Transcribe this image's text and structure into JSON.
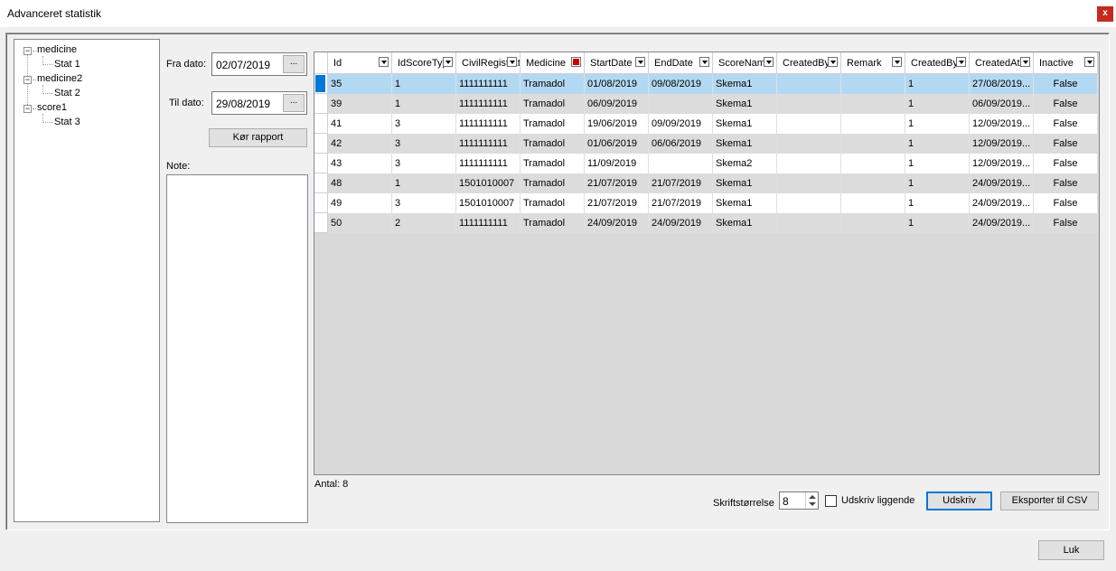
{
  "window": {
    "title": "Advanceret statistik",
    "close_label": "x"
  },
  "tree": {
    "nodes": [
      {
        "label": "medicine",
        "children": [
          "Stat 1"
        ]
      },
      {
        "label": "medicine2",
        "children": [
          "Stat 2"
        ]
      },
      {
        "label": "score1",
        "children": [
          "Stat 3"
        ]
      }
    ],
    "expander_glyph": "−"
  },
  "filters": {
    "from_label": "Fra dato:",
    "from_value": "02/07/2019",
    "to_label": "Til dato:",
    "to_value": "29/08/2019",
    "picker_label": "...",
    "run_button": "Kør rapport",
    "note_label": "Note:"
  },
  "grid": {
    "columns": [
      {
        "label": "Id",
        "width": 71,
        "filter_active": false
      },
      {
        "label": "IdScoreType",
        "width": 71,
        "filter_active": false
      },
      {
        "label": "CivilRegistrationNumber",
        "width": 71,
        "filter_active": false
      },
      {
        "label": "Medicine",
        "width": 71,
        "filter_active": true
      },
      {
        "label": "StartDate",
        "width": 71,
        "filter_active": false
      },
      {
        "label": "EndDate",
        "width": 71,
        "filter_active": false
      },
      {
        "label": "ScoreName",
        "width": 71,
        "filter_active": false
      },
      {
        "label": "CreatedBy",
        "width": 71,
        "filter_active": false
      },
      {
        "label": "Remark",
        "width": 71,
        "filter_active": false
      },
      {
        "label": "CreatedBy",
        "width": 71,
        "filter_active": false
      },
      {
        "label": "CreatedAt",
        "width": 71,
        "filter_active": false
      },
      {
        "label": "Inactive",
        "width": 71,
        "filter_active": false
      }
    ],
    "rows": [
      [
        "35",
        "1",
        "1111111111",
        "Tramadol",
        "01/08/2019",
        "09/08/2019",
        "Skema1",
        "",
        "",
        "1",
        "27/08/2019...",
        "False"
      ],
      [
        "39",
        "1",
        "1111111111",
        "Tramadol",
        "06/09/2019",
        "",
        "Skema1",
        "",
        "",
        "1",
        "06/09/2019...",
        "False"
      ],
      [
        "41",
        "3",
        "1111111111",
        "Tramadol",
        "19/06/2019",
        "09/09/2019",
        "Skema1",
        "",
        "",
        "1",
        "12/09/2019...",
        "False"
      ],
      [
        "42",
        "3",
        "1111111111",
        "Tramadol",
        "01/06/2019",
        "06/06/2019",
        "Skema1",
        "",
        "",
        "1",
        "12/09/2019...",
        "False"
      ],
      [
        "43",
        "3",
        "1111111111",
        "Tramadol",
        "11/09/2019",
        "",
        "Skema2",
        "",
        "",
        "1",
        "12/09/2019...",
        "False"
      ],
      [
        "48",
        "1",
        "1501010007",
        "Tramadol",
        "21/07/2019",
        "21/07/2019",
        "Skema1",
        "",
        "",
        "1",
        "24/09/2019...",
        "False"
      ],
      [
        "49",
        "3",
        "1501010007",
        "Tramadol",
        "21/07/2019",
        "21/07/2019",
        "Skema1",
        "",
        "",
        "1",
        "24/09/2019...",
        "False"
      ],
      [
        "50",
        "2",
        "1111111111",
        "Tramadol",
        "24/09/2019",
        "24/09/2019",
        "Skema1",
        "",
        "",
        "1",
        "24/09/2019...",
        "False"
      ]
    ],
    "selected_row": 0
  },
  "footer": {
    "count_label": "Antal: 8",
    "font_size_label": "Skriftstørrelse",
    "font_size_value": "8",
    "landscape_label": "Udskriv liggende",
    "landscape_checked": false,
    "print_button": "Udskriv",
    "export_button": "Eksporter til CSV",
    "close_button": "Luk"
  },
  "colors": {
    "selection": "#b3d9f2",
    "accent": "#0078d7",
    "close": "#c42b1c"
  }
}
